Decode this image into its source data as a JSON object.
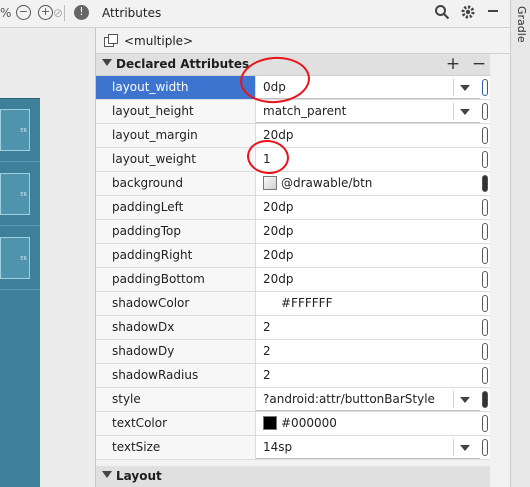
{
  "left_toolbar": {
    "percent_text": "%",
    "plus_glyph": "+",
    "info_glyph": "!",
    "slash_glyph": "⊘"
  },
  "canvas": {
    "buttons": [
      "ER",
      "ER",
      "ER"
    ]
  },
  "panel": {
    "title": "Attributes",
    "component_name": "<multiple>",
    "gradle_tab": "Gradle"
  },
  "sections": {
    "declared_title": "Declared Attributes",
    "layout_title": "Layout",
    "add_glyph": "+",
    "remove_glyph": "−"
  },
  "attributes": [
    {
      "name": "layout_width",
      "value": "0dp",
      "dropdown": true,
      "pill": "outline"
    },
    {
      "name": "layout_height",
      "value": "match_parent",
      "dropdown": true,
      "pill": "outline"
    },
    {
      "name": "layout_margin",
      "value": "20dp",
      "dropdown": false,
      "pill": "outline"
    },
    {
      "name": "layout_weight",
      "value": "1",
      "dropdown": false,
      "pill": "outline"
    },
    {
      "name": "background",
      "value": "@drawable/btn",
      "dropdown": false,
      "pill": "filled",
      "swatch": "light"
    },
    {
      "name": "paddingLeft",
      "value": "20dp",
      "dropdown": false,
      "pill": "outline"
    },
    {
      "name": "paddingTop",
      "value": "20dp",
      "dropdown": false,
      "pill": "outline"
    },
    {
      "name": "paddingRight",
      "value": "20dp",
      "dropdown": false,
      "pill": "outline"
    },
    {
      "name": "paddingBottom",
      "value": "20dp",
      "dropdown": false,
      "pill": "outline"
    },
    {
      "name": "shadowColor",
      "value": "#FFFFFF",
      "dropdown": false,
      "pill": "outline",
      "indent": true
    },
    {
      "name": "shadowDx",
      "value": "2",
      "dropdown": false,
      "pill": "outline"
    },
    {
      "name": "shadowDy",
      "value": "2",
      "dropdown": false,
      "pill": "outline"
    },
    {
      "name": "shadowRadius",
      "value": "2",
      "dropdown": false,
      "pill": "outline"
    },
    {
      "name": "style",
      "value": "?android:attr/buttonBarStyle",
      "dropdown": true,
      "pill": "filled"
    },
    {
      "name": "textColor",
      "value": "#000000",
      "dropdown": false,
      "pill": "outline",
      "swatch": "black"
    },
    {
      "name": "textSize",
      "value": "14sp",
      "dropdown": true,
      "pill": "outline"
    }
  ],
  "colors": {
    "selection": "#3d74cf",
    "annotation": "#e8141a",
    "canvas": "#3e7f99"
  }
}
